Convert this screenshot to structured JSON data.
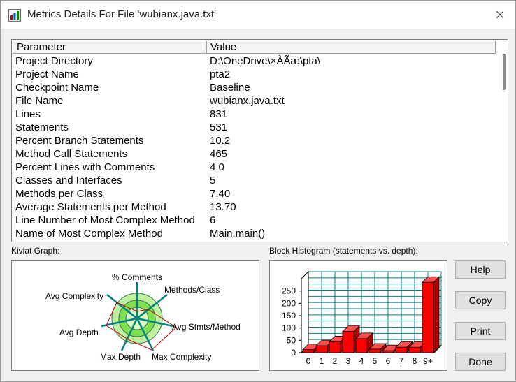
{
  "window": {
    "title": "Metrics Details For File 'wubianx.java.txt'",
    "icon": "metrics-chart-icon",
    "close_icon": "close-icon"
  },
  "table": {
    "columns": [
      "Parameter",
      "Value"
    ],
    "rows": [
      {
        "param": "Project Directory",
        "value": "D:\\OneDrive\\×ÀÃæ\\pta\\"
      },
      {
        "param": "Project Name",
        "value": "pta2"
      },
      {
        "param": "Checkpoint Name",
        "value": "Baseline"
      },
      {
        "param": "File Name",
        "value": "wubianx.java.txt"
      },
      {
        "param": "Lines",
        "value": "831"
      },
      {
        "param": "Statements",
        "value": "531"
      },
      {
        "param": "Percent Branch Statements",
        "value": "10.2"
      },
      {
        "param": "Method Call Statements",
        "value": "465"
      },
      {
        "param": "Percent Lines with Comments",
        "value": "4.0"
      },
      {
        "param": "Classes and Interfaces",
        "value": "5"
      },
      {
        "param": "Methods per Class",
        "value": "7.40"
      },
      {
        "param": "Average Statements per Method",
        "value": "13.70"
      },
      {
        "param": "Line Number of Most Complex Method",
        "value": "6"
      },
      {
        "param": "Name of Most Complex Method",
        "value": "Main.main()"
      }
    ]
  },
  "kiviat": {
    "label": "Kiviat Graph:",
    "axes": [
      "% Comments",
      "Methods/Class",
      "Avg Stmts/Method",
      "Max Complexity",
      "Max Depth",
      "Avg Depth",
      "Avg Complexity"
    ]
  },
  "histogram": {
    "label": "Block Histogram (statements vs. depth):"
  },
  "chart_data": {
    "type": "bar",
    "categories": [
      "0",
      "1",
      "2",
      "3",
      "4",
      "5",
      "6",
      "7",
      "8",
      "9+"
    ],
    "values": [
      12,
      28,
      44,
      86,
      57,
      14,
      8,
      22,
      22,
      285
    ],
    "title": "",
    "xlabel": "",
    "ylabel": "",
    "yticks": [
      0,
      50,
      100,
      150,
      200,
      250
    ],
    "ylim": [
      0,
      300
    ],
    "grid": true,
    "bar_color": "#ff0000"
  },
  "buttons": {
    "help": "Help",
    "copy": "Copy",
    "print": "Print",
    "done": "Done"
  }
}
